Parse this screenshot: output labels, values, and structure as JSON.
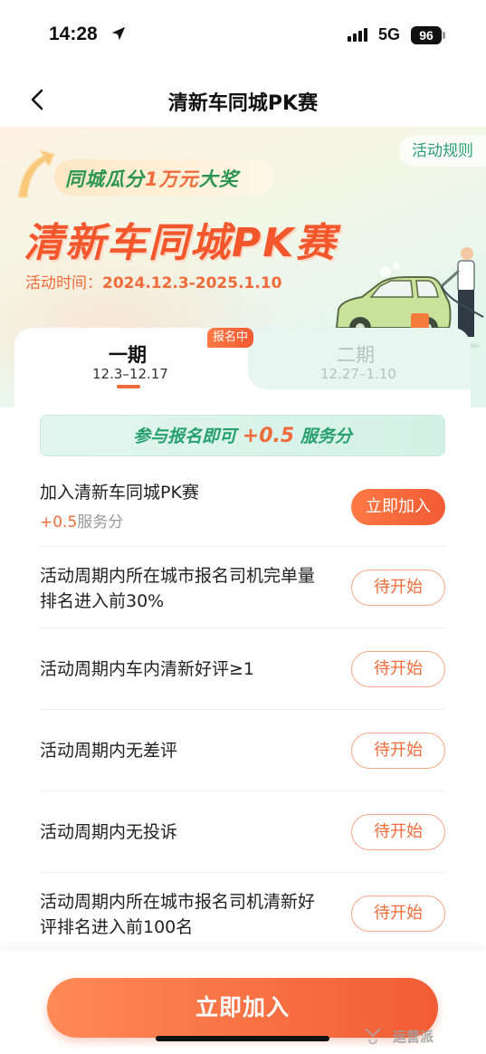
{
  "status_bar": {
    "time": "14:28",
    "network": "5G",
    "battery": "96"
  },
  "nav": {
    "title": "清新车同城PK赛"
  },
  "hero": {
    "rules_label": "活动规则",
    "subtitle_prefix": "同城瓜分",
    "subtitle_highlight": "1万元",
    "subtitle_suffix": "大奖",
    "title": "清新车同城PK赛",
    "date_label": "活动时间：",
    "date_value": "2024.12.3-2025.1.10"
  },
  "tabs": [
    {
      "label": "一期",
      "dates": "12.3–12.17",
      "badge": "报名中",
      "active": true
    },
    {
      "label": "二期",
      "dates": "12.27–1.10",
      "active": false
    }
  ],
  "banner": {
    "prefix": "参与报名即可",
    "points": "+0.5",
    "suffix": "服务分"
  },
  "tasks": [
    {
      "title": "加入清新车同城PK赛",
      "reward_points": "+0.5",
      "reward_unit": "服务分",
      "button": "立即加入"
    },
    {
      "title": "活动周期内所在城市报名司机完单量排名进入前30%",
      "button": "待开始"
    },
    {
      "title": "活动周期内车内清新好评≥1",
      "button": "待开始"
    },
    {
      "title": "活动周期内无差评",
      "button": "待开始"
    },
    {
      "title": "活动周期内无投诉",
      "button": "待开始"
    },
    {
      "title": "活动周期内所在城市报名司机清新好评排名进入前100名",
      "button": "待开始"
    }
  ],
  "footer": {
    "cta": "立即加入",
    "watermark": "运营派"
  },
  "colors": {
    "accent": "#f06b3a",
    "green": "#27a06e"
  }
}
